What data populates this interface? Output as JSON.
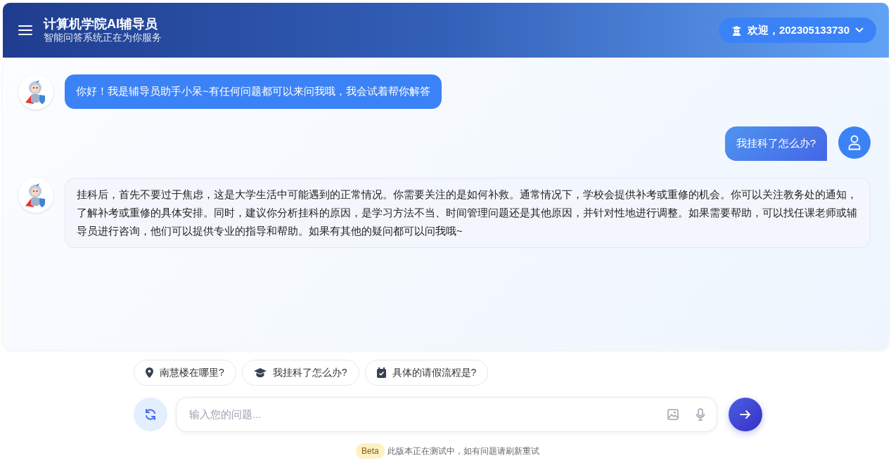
{
  "header": {
    "title": "计算机学院AI辅导员",
    "subtitle": "智能问答系统正在为你服务",
    "user_menu": "欢迎，202305133730"
  },
  "messages": [
    {
      "kind": "bot",
      "text": "你好！我是辅导员助手小呆~有任何问题都可以来问我哦，我会试着帮你解答"
    },
    {
      "kind": "user",
      "text": "我挂科了怎么办?"
    },
    {
      "kind": "bot_reply",
      "text": "挂科后，首先不要过于焦虑，这是大学生活中可能遇到的正常情况。你需要关注的是如何补救。通常情况下，学校会提供补考或重修的机会。你可以关注教务处的通知，了解补考或重修的具体安排。同时，建议你分析挂科的原因，是学习方法不当、时间管理问题还是其他原因，并针对性地进行调整。如果需要帮助，可以找任课老师或辅导员进行咨询，他们可以提供专业的指导和帮助。如果有其他的疑问都可以问我哦~"
    }
  ],
  "suggestions": [
    {
      "kind": "location",
      "label": "南慧楼在哪里?"
    },
    {
      "kind": "study",
      "label": "我挂科了怎么办?"
    },
    {
      "kind": "calendar",
      "label": "具体的请假流程是?"
    }
  ],
  "input": {
    "placeholder": "输入您的问题..."
  },
  "footer": {
    "badge": "Beta",
    "note": "此版本正在测试中，如有问题请刷新重试"
  }
}
